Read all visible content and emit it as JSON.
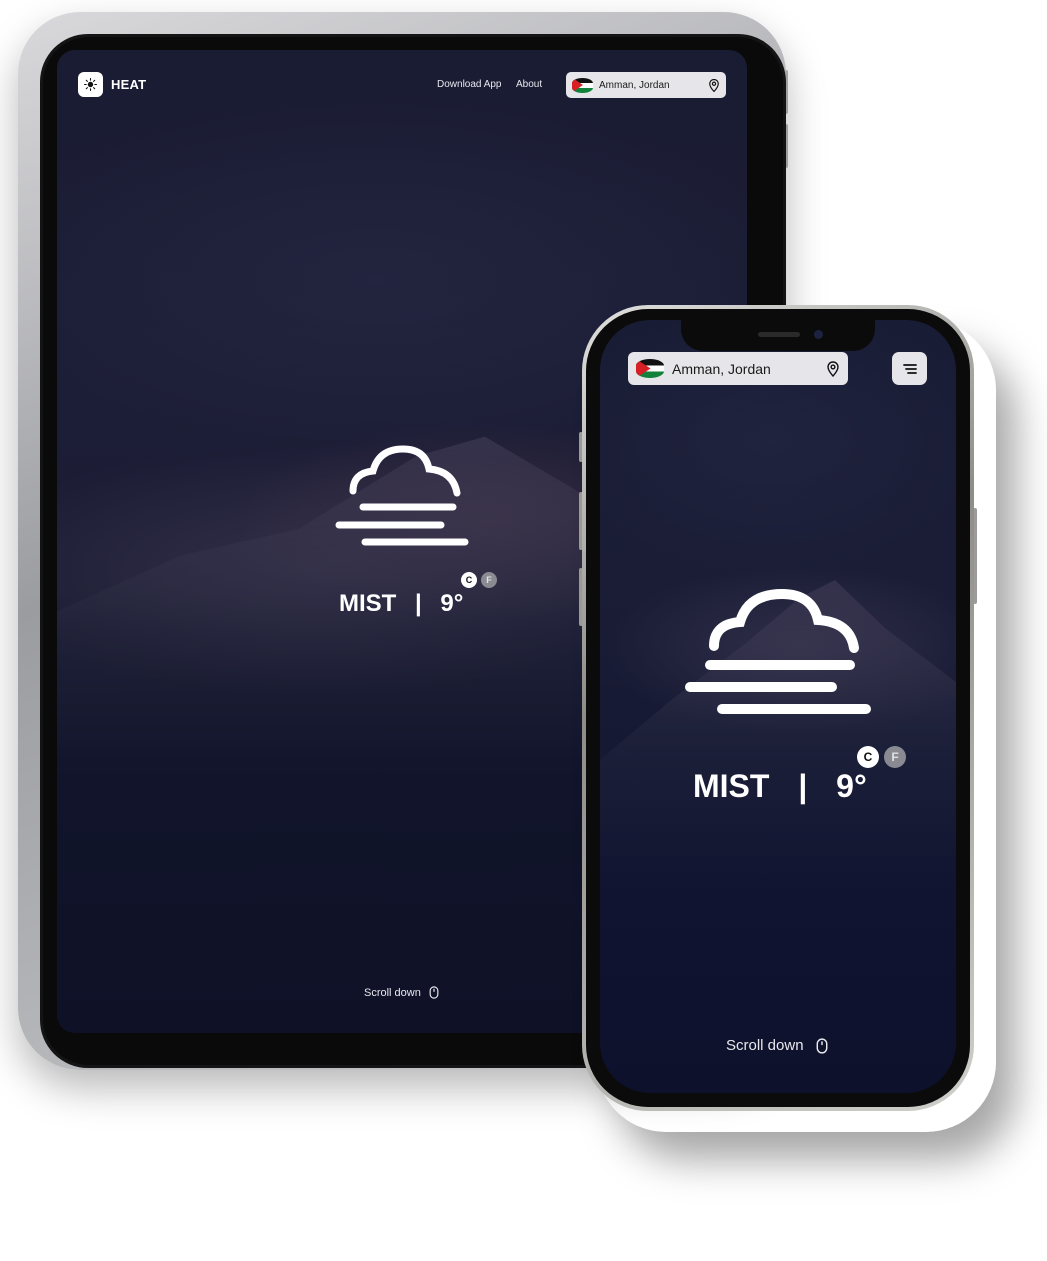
{
  "brand": {
    "name": "HEAT"
  },
  "nav": {
    "download_app": "Download App",
    "about": "About"
  },
  "location": {
    "label": "Amman, Jordan",
    "flag": "jordan-flag",
    "icon": "location-pin-icon"
  },
  "weather": {
    "condition": "MIST",
    "separator": "|",
    "temperature": "9°",
    "icon": "mist-icon",
    "units": {
      "celsius": "C",
      "fahrenheit": "F",
      "selected": "C"
    }
  },
  "scroll_hint": {
    "label": "Scroll down",
    "icon": "mouse-icon"
  },
  "menu": {
    "icon": "menu-icon"
  },
  "colors": {
    "background": "#1b1d34",
    "pill": "#e6e6ea",
    "text": "#ffffff",
    "unit_inactive": "#8a8a92"
  }
}
